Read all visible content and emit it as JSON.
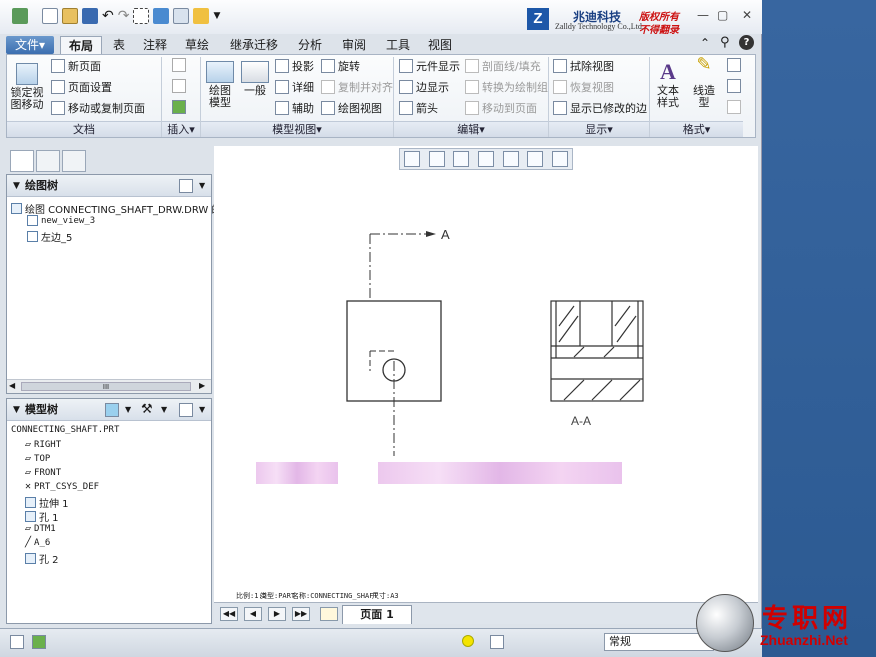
{
  "titlebar": {
    "logo_letter": "Z",
    "company_cn": "兆迪科技",
    "company_en": "Zalldy Technology Co.,Ltd.",
    "slogan_line1": "版权所有",
    "slogan_line2": "不得翻录",
    "minimize": "—",
    "restore": "▢",
    "close": "✕"
  },
  "tabs": {
    "file": "文件▾",
    "items": [
      "布局",
      "表",
      "注释",
      "草绘",
      "继承迁移",
      "分析",
      "审阅",
      "工具",
      "视图"
    ],
    "active": "布局"
  },
  "ribbon": {
    "doc": {
      "lock_move": "锁定视图移动",
      "new_page": "新页面",
      "page_setup": "页面设置",
      "move_copy_page": "移动或复制页面",
      "label": "文档"
    },
    "insert": {
      "label": "插入▾"
    },
    "model_view": {
      "drawing_model": "绘图模型",
      "general": "一般",
      "projection": "投影",
      "detail": "详细",
      "auxiliary": "辅助",
      "revolve": "旋转",
      "copy_align": "复制并对齐",
      "drawing_view": "绘图视图",
      "label": "模型视图▾"
    },
    "edit": {
      "component_display": "元件显示",
      "edge_display": "边显示",
      "arrow": "箭头",
      "section_line": "剖面线/填充",
      "convert": "转换为绘制组",
      "move_to_page": "移动到页面",
      "label": "编辑▾"
    },
    "display": {
      "erase_view": "拭除视图",
      "restore_view": "恢复视图",
      "show_modified_edges": "显示已修改的边",
      "label": "显示▾"
    },
    "format": {
      "text_style": "文本样式",
      "line_style": "线造型",
      "label": "格式▾"
    }
  },
  "drawing_tree": {
    "title": "绘图树",
    "items": [
      "绘图 CONNECTING_SHAFT_DRW.DRW 的第",
      "new_view_3",
      "左边_5"
    ],
    "scroll_mark": "III"
  },
  "model_tree": {
    "title": "模型树",
    "items": [
      "CONNECTING_SHAFT.PRT",
      "RIGHT",
      "TOP",
      "FRONT",
      "PRT_CSYS_DEF",
      "拉伸 1",
      "孔 1",
      "DTM1",
      "A_6",
      "孔 2"
    ]
  },
  "canvas": {
    "section_letter": "A",
    "section_label": "A-A",
    "info_scale": "比例:1:2",
    "info_type": "类型:PART",
    "info_name": "名称:CONNECTING_SHAFT",
    "info_size": "尺寸:A3"
  },
  "pagebar": {
    "first": "◀◀",
    "prev": "◀",
    "next": "▶",
    "last": "▶▶",
    "page_tab": "页面 1"
  },
  "statusbar": {
    "filter": "常规"
  },
  "watermark": {
    "cn": "专职网",
    "url": "Zhuanzhi.Net"
  }
}
